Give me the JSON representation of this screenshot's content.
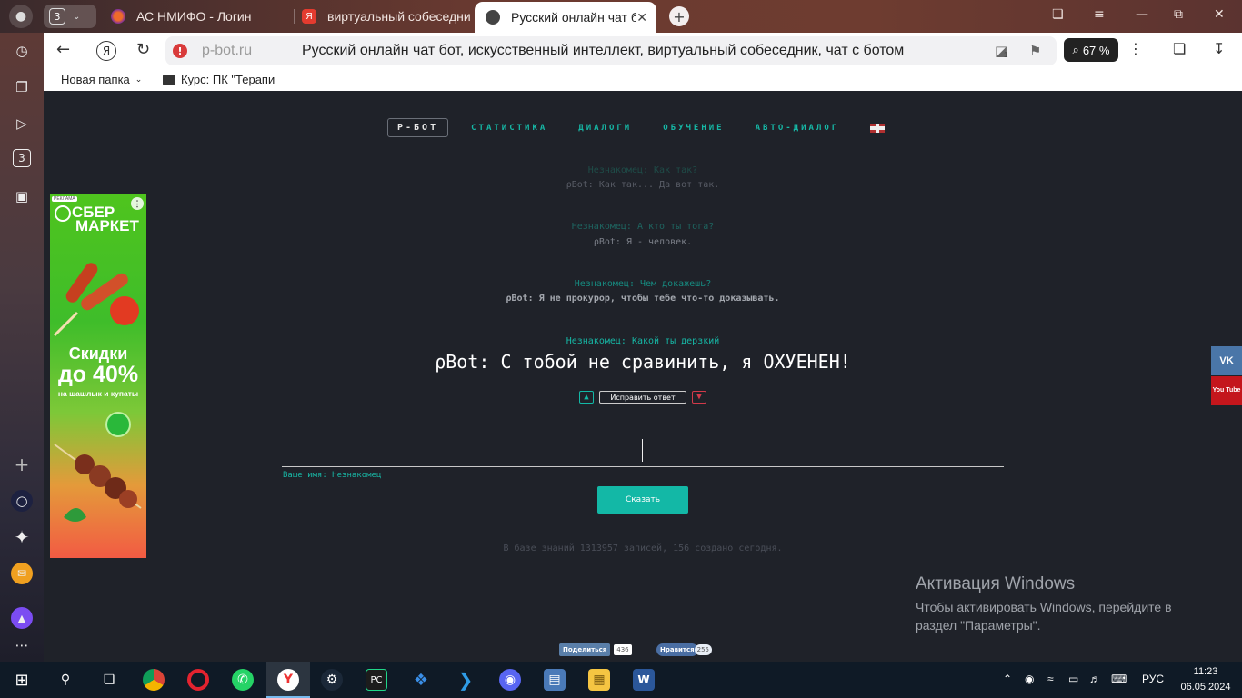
{
  "browser": {
    "tab_group_count": "3",
    "tabs": [
      {
        "title": "АС НМИФО - Логин"
      },
      {
        "title": "виртуальный собеседник"
      },
      {
        "title": "Русский онлайн чат бот"
      }
    ],
    "domain": "p-bot.ru",
    "page_title": "Русский онлайн чат бот, искусственный интеллект, виртуальный собеседник, чат с ботом",
    "zoom": "67 %",
    "badge_count": "1",
    "bookmarks": [
      {
        "label": "Новая папка"
      },
      {
        "label": "Курс: ПК \"Терапи"
      }
    ],
    "sidebar_badge": "3"
  },
  "site": {
    "nav": {
      "brand": "Р-БОТ",
      "links": [
        "СТАТИСТИКА",
        "ДИАЛОГИ",
        "ОБУЧЕНИЕ",
        "АВТО-ДИАЛОГ"
      ]
    },
    "history": [
      {
        "user": "Незнакомец: Как так?",
        "bot": "ρBot: Как так... Да вот так."
      },
      {
        "user": "Незнакомец: А кто ты тога?",
        "bot": "ρBot: Я - человек."
      },
      {
        "user": "Незнакомец: Чем докажешь?",
        "bot": "ρBot: Я не прокурор, чтобы тебе что-то доказывать."
      }
    ],
    "current": {
      "user": "Незнакомец: Какой ты дерзкий",
      "bot": "ρBot: С тобой не сравинить, я ОХУЕНЕН!"
    },
    "fix_button": "Исправить ответ",
    "name_label": "Ваше имя: Незнакомец",
    "say_button": "Сказать",
    "stats": "В базе знаний 1313957 записей, 156 создано сегодня.",
    "share_vk": "Поделиться",
    "share_vk_count": "436",
    "share_ok": "Нравится",
    "share_ok_count": "255"
  },
  "ad": {
    "tag": "РЕКЛАМА",
    "brand_line1": "СБЕР",
    "brand_line2": "МАРКЕТ",
    "promo_line1": "Скидки",
    "promo_line2": "до 40%",
    "promo_line3": "на шашлык и купаты"
  },
  "windows": {
    "activation_title": "Активация Windows",
    "activation_text": "Чтобы активировать Windows, перейдите в раздел \"Параметры\".",
    "lang": "РУС",
    "time": "11:23",
    "date": "06.05.2024"
  },
  "social": {
    "vk": "VK",
    "youtube": "You Tube"
  },
  "colors": {
    "accent": "#13b8a6",
    "page_bg": "#1f2229",
    "like_green": "#13b8a6",
    "dislike_red": "#d23a4a"
  }
}
